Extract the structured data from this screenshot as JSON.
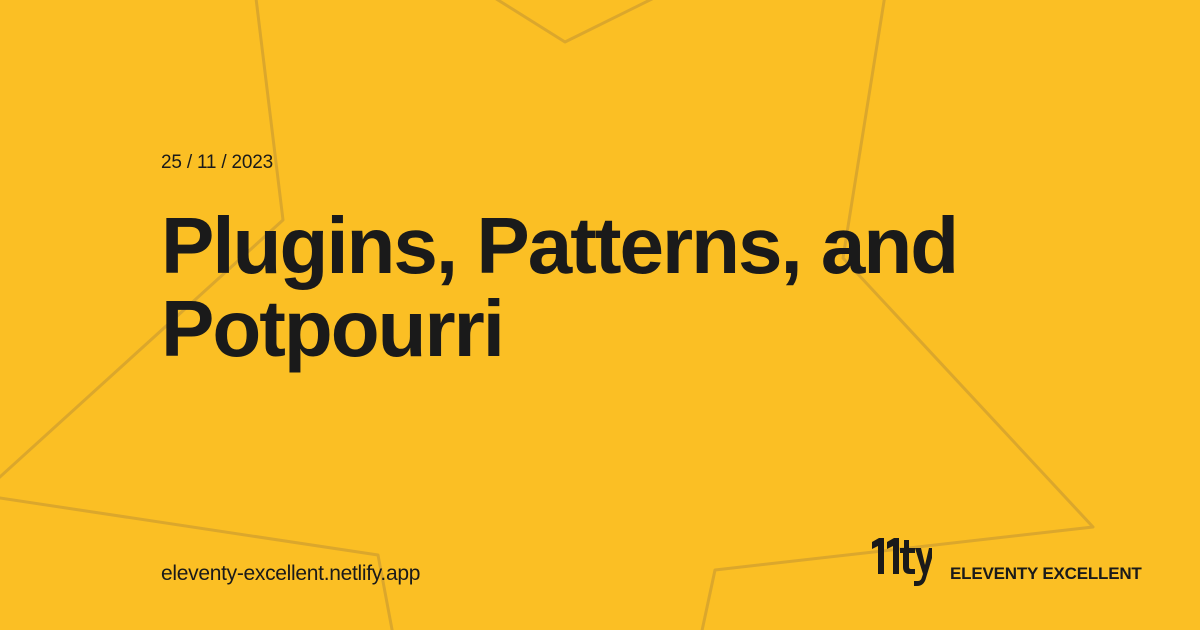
{
  "theme": {
    "background": "#FBBF24",
    "text": "#1A1A1A",
    "outline": "#DBA72C"
  },
  "post": {
    "date": "25 / 11 / 2023",
    "title_line_1": "Plugins, Patterns, and",
    "title_line_2": "Potpourri"
  },
  "footer": {
    "site_url": "eleventy-excellent.netlify.app",
    "brand_name": "ELEVENTY EXCELLENT",
    "logo_icon": "eleventy-logo-icon"
  }
}
